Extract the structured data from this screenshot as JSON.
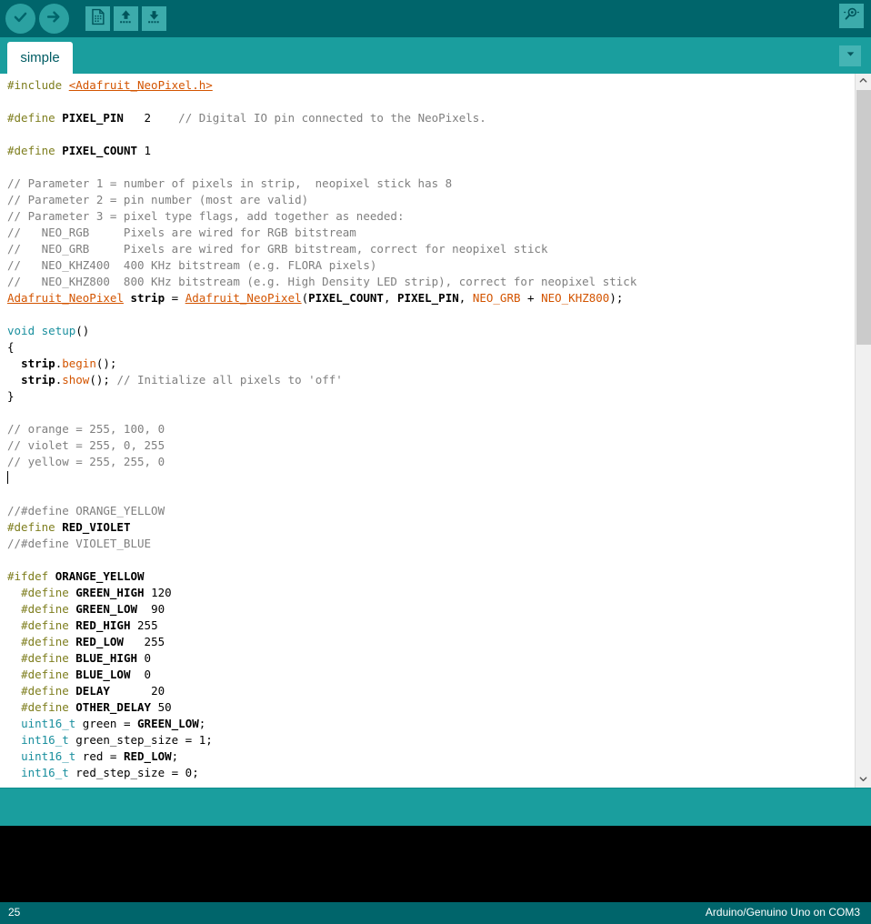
{
  "toolbar": {
    "buttons": [
      {
        "name": "verify-button",
        "label": "Verify",
        "icon": "check-icon"
      },
      {
        "name": "upload-button",
        "label": "Upload",
        "icon": "arrow-right-icon"
      },
      {
        "name": "new-button",
        "label": "New",
        "icon": "new-file-icon"
      },
      {
        "name": "open-button",
        "label": "Open",
        "icon": "open-folder-up-arrow-icon"
      },
      {
        "name": "save-button",
        "label": "Save",
        "icon": "save-down-arrow-icon"
      }
    ],
    "serial_monitor": {
      "name": "serial-monitor-button",
      "label": "Serial Monitor",
      "icon": "magnifier-icon"
    },
    "bg_color": "#00656b"
  },
  "tabbar": {
    "tabs": [
      {
        "label": "simple",
        "active": true
      }
    ],
    "menu_icon": "chevron-down-icon",
    "bg_color": "#1a9e9e"
  },
  "editor": {
    "scrollbar": {
      "up_icon": "chevron-up-icon",
      "down_icon": "chevron-down-icon"
    },
    "lines": [
      [
        {
          "t": "#include ",
          "c": "k-pre"
        },
        {
          "t": "<Adafruit_NeoPixel.h>",
          "c": "k-inc"
        }
      ],
      [],
      [
        {
          "t": "#define ",
          "c": "k-pre"
        },
        {
          "t": "PIXEL_PIN",
          "c": "k-id"
        },
        {
          "t": "   2    "
        },
        {
          "t": "// Digital IO pin connected to the NeoPixels.",
          "c": "k-cmt"
        }
      ],
      [],
      [
        {
          "t": "#define ",
          "c": "k-pre"
        },
        {
          "t": "PIXEL_COUNT",
          "c": "k-id"
        },
        {
          "t": " 1"
        }
      ],
      [],
      [
        {
          "t": "// Parameter 1 = number of pixels in strip,  neopixel stick has 8",
          "c": "k-cmt"
        }
      ],
      [
        {
          "t": "// Parameter 2 = pin number (most are valid)",
          "c": "k-cmt"
        }
      ],
      [
        {
          "t": "// Parameter 3 = pixel type flags, add together as needed:",
          "c": "k-cmt"
        }
      ],
      [
        {
          "t": "//   NEO_RGB     Pixels are wired for RGB bitstream",
          "c": "k-cmt"
        }
      ],
      [
        {
          "t": "//   NEO_GRB     Pixels are wired for GRB bitstream, correct for neopixel stick",
          "c": "k-cmt"
        }
      ],
      [
        {
          "t": "//   NEO_KHZ400  400 KHz bitstream (e.g. FLORA pixels)",
          "c": "k-cmt"
        }
      ],
      [
        {
          "t": "//   NEO_KHZ800  800 KHz bitstream (e.g. High Density LED strip), correct for neopixel stick",
          "c": "k-cmt"
        }
      ],
      [
        {
          "t": "Adafruit_NeoPixel",
          "c": "k-cls"
        },
        {
          "t": " "
        },
        {
          "t": "strip",
          "c": "k-id"
        },
        {
          "t": " = "
        },
        {
          "t": "Adafruit_NeoPixel",
          "c": "k-cls"
        },
        {
          "t": "("
        },
        {
          "t": "PIXEL_COUNT",
          "c": "k-id"
        },
        {
          "t": ", "
        },
        {
          "t": "PIXEL_PIN",
          "c": "k-id"
        },
        {
          "t": ", "
        },
        {
          "t": "NEO_GRB",
          "c": "k-con"
        },
        {
          "t": " + "
        },
        {
          "t": "NEO_KHZ800",
          "c": "k-con"
        },
        {
          "t": ");"
        }
      ],
      [],
      [
        {
          "t": "void",
          "c": "k-type"
        },
        {
          "t": " "
        },
        {
          "t": "setup",
          "c": "k-fn"
        },
        {
          "t": "()"
        }
      ],
      [
        {
          "t": "{"
        }
      ],
      [
        {
          "t": "  "
        },
        {
          "t": "strip",
          "c": "k-id"
        },
        {
          "t": "."
        },
        {
          "t": "begin",
          "c": "k-mth"
        },
        {
          "t": "();"
        }
      ],
      [
        {
          "t": "  "
        },
        {
          "t": "strip",
          "c": "k-id"
        },
        {
          "t": "."
        },
        {
          "t": "show",
          "c": "k-mth"
        },
        {
          "t": "(); "
        },
        {
          "t": "// Initialize all pixels to 'off'",
          "c": "k-cmt"
        }
      ],
      [
        {
          "t": "}"
        }
      ],
      [],
      [
        {
          "t": "// orange = 255, 100, 0",
          "c": "k-cmt"
        }
      ],
      [
        {
          "t": "// violet = 255, 0, 255",
          "c": "k-cmt"
        }
      ],
      [
        {
          "t": "// yellow = 255, 255, 0",
          "c": "k-cmt"
        }
      ],
      [
        {
          "t": "",
          "caret": true
        }
      ],
      [],
      [
        {
          "t": "//#define ORANGE_YELLOW",
          "c": "k-cmt"
        }
      ],
      [
        {
          "t": "#define ",
          "c": "k-pre"
        },
        {
          "t": "RED_VIOLET",
          "c": "k-id"
        }
      ],
      [
        {
          "t": "//#define VIOLET_BLUE",
          "c": "k-cmt"
        }
      ],
      [],
      [
        {
          "t": "#ifdef ",
          "c": "k-pre"
        },
        {
          "t": "ORANGE_YELLOW",
          "c": "k-id"
        }
      ],
      [
        {
          "t": "  "
        },
        {
          "t": "#define ",
          "c": "k-pre"
        },
        {
          "t": "GREEN_HIGH",
          "c": "k-id"
        },
        {
          "t": " 120"
        }
      ],
      [
        {
          "t": "  "
        },
        {
          "t": "#define ",
          "c": "k-pre"
        },
        {
          "t": "GREEN_LOW",
          "c": "k-id"
        },
        {
          "t": "  90"
        }
      ],
      [
        {
          "t": "  "
        },
        {
          "t": "#define ",
          "c": "k-pre"
        },
        {
          "t": "RED_HIGH",
          "c": "k-id"
        },
        {
          "t": " 255"
        }
      ],
      [
        {
          "t": "  "
        },
        {
          "t": "#define ",
          "c": "k-pre"
        },
        {
          "t": "RED_LOW",
          "c": "k-id"
        },
        {
          "t": "   255"
        }
      ],
      [
        {
          "t": "  "
        },
        {
          "t": "#define ",
          "c": "k-pre"
        },
        {
          "t": "BLUE_HIGH",
          "c": "k-id"
        },
        {
          "t": " 0"
        }
      ],
      [
        {
          "t": "  "
        },
        {
          "t": "#define ",
          "c": "k-pre"
        },
        {
          "t": "BLUE_LOW",
          "c": "k-id"
        },
        {
          "t": "  0"
        }
      ],
      [
        {
          "t": "  "
        },
        {
          "t": "#define ",
          "c": "k-pre"
        },
        {
          "t": "DELAY",
          "c": "k-id"
        },
        {
          "t": "      20"
        }
      ],
      [
        {
          "t": "  "
        },
        {
          "t": "#define ",
          "c": "k-pre"
        },
        {
          "t": "OTHER_DELAY",
          "c": "k-id"
        },
        {
          "t": " 50"
        }
      ],
      [
        {
          "t": "  "
        },
        {
          "t": "uint16_t",
          "c": "k-type"
        },
        {
          "t": " green = "
        },
        {
          "t": "GREEN_LOW",
          "c": "k-id"
        },
        {
          "t": ";"
        }
      ],
      [
        {
          "t": "  "
        },
        {
          "t": "int16_t",
          "c": "k-type"
        },
        {
          "t": " green_step_size = 1;"
        }
      ],
      [
        {
          "t": "  "
        },
        {
          "t": "uint16_t",
          "c": "k-type"
        },
        {
          "t": " red = "
        },
        {
          "t": "RED_LOW",
          "c": "k-id"
        },
        {
          "t": ";"
        }
      ],
      [
        {
          "t": "  "
        },
        {
          "t": "int16_t",
          "c": "k-type"
        },
        {
          "t": " red_step_size = 0;"
        }
      ]
    ]
  },
  "console": {
    "text": ""
  },
  "bottombar": {
    "line_number": "25",
    "board_status": "Arduino/Genuino Uno on COM3",
    "bg_color": "#00656b"
  }
}
